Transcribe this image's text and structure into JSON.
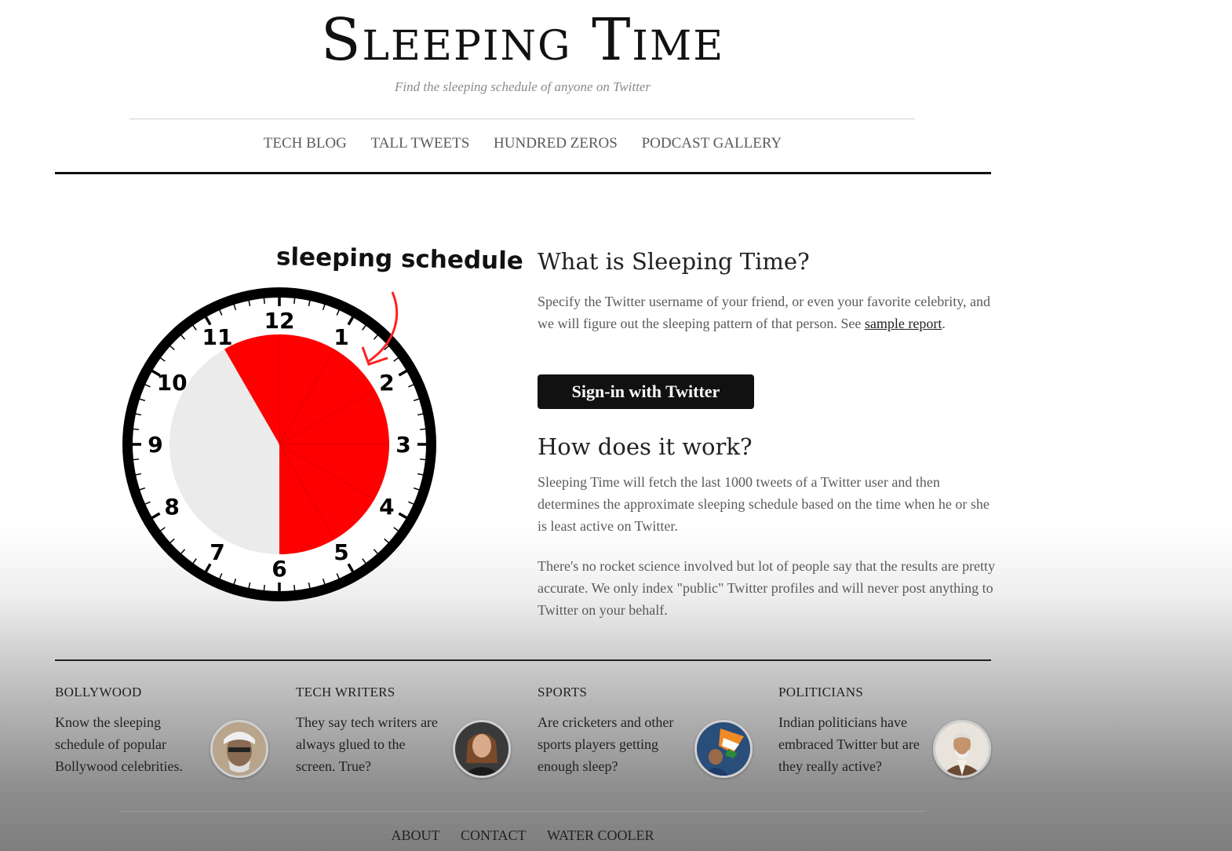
{
  "header": {
    "title": "Sleeping Time",
    "tagline": "Find the sleeping schedule of anyone on Twitter"
  },
  "nav": [
    "TECH BLOG",
    "TALL TWEETS",
    "HUNDRED ZEROS",
    "PODCAST GALLERY"
  ],
  "clock": {
    "label": "sleeping schedule",
    "numbers": [
      "12",
      "1",
      "2",
      "3",
      "4",
      "5",
      "6",
      "7",
      "8",
      "9",
      "10",
      "11"
    ],
    "sleep_start_hour": 11,
    "sleep_end_hour": 6,
    "colors": {
      "sleep": "#ff0000",
      "face": "#ffffff",
      "inner": "#ebebeb",
      "rim": "#000000"
    }
  },
  "about": {
    "heading": "What is Sleeping Time?",
    "text_before_link": "Specify the Twitter username of your friend, or even your favorite celebrity, and we will figure out the sleeping pattern of that person. See ",
    "link_text": "sample report",
    "text_after_link": ".",
    "signin_label": "Sign-in with Twitter"
  },
  "how": {
    "heading": "How does it work?",
    "para1": "Sleeping Time will fetch the last 1000 tweets of a Twitter user and then determines the approximate sleeping schedule based on the time when he or she is least active on Twitter.",
    "para2": "There's no rocket science involved but lot of people say that the results are pretty accurate. We only index \"public\" Twitter profiles and will never post anything to Twitter on your behalf."
  },
  "categories": [
    {
      "title": "BOLLYWOOD",
      "text": "Know the sleeping schedule of popular Bollywood celebrities.",
      "avatar": "bollywood-avatar"
    },
    {
      "title": "TECH WRITERS",
      "text": "They say tech writers are always glued to the screen. True?",
      "avatar": "tech-writer-avatar"
    },
    {
      "title": "SPORTS",
      "text": "Are cricketers and other sports players getting enough sleep?",
      "avatar": "sports-avatar"
    },
    {
      "title": "POLITICIANS",
      "text": "Indian politicians have embraced Twitter but are they really active?",
      "avatar": "politician-avatar"
    }
  ],
  "footer": [
    "ABOUT",
    "CONTACT",
    "WATER COOLER"
  ]
}
